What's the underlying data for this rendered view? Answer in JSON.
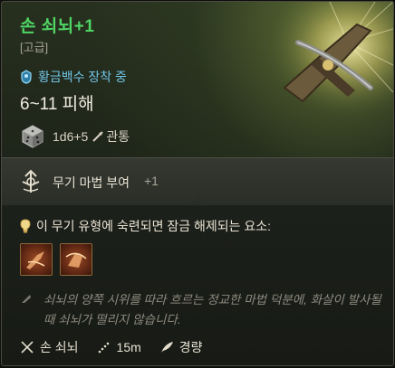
{
  "item": {
    "name": "손 쇠뇌+1",
    "rarity": "[고급]",
    "equip_status": "황금백수 장착 중",
    "damage": "6~11 피해",
    "dice": "1d6+5",
    "damage_type": "관통"
  },
  "enchant": {
    "label": "무기 마법 부여",
    "bonus": "+1"
  },
  "proficiency": {
    "header": "이 무기 유형에 숙련되면 잠금 해제되는 요소:",
    "actions": [
      "action-1",
      "action-2"
    ]
  },
  "flavor_text": "쇠뇌의 양쪽 시위를 따라 흐르는 정교한 마법 덕분에, 화살이 발사될 때 쇠뇌가 떨리지 않습니다.",
  "properties": {
    "type": "손 쇠뇌",
    "range": "15m",
    "weight": "경량"
  },
  "colors": {
    "name": "#4fd564",
    "equip": "#6fc4e6",
    "flavor": "#8e8a7f"
  }
}
